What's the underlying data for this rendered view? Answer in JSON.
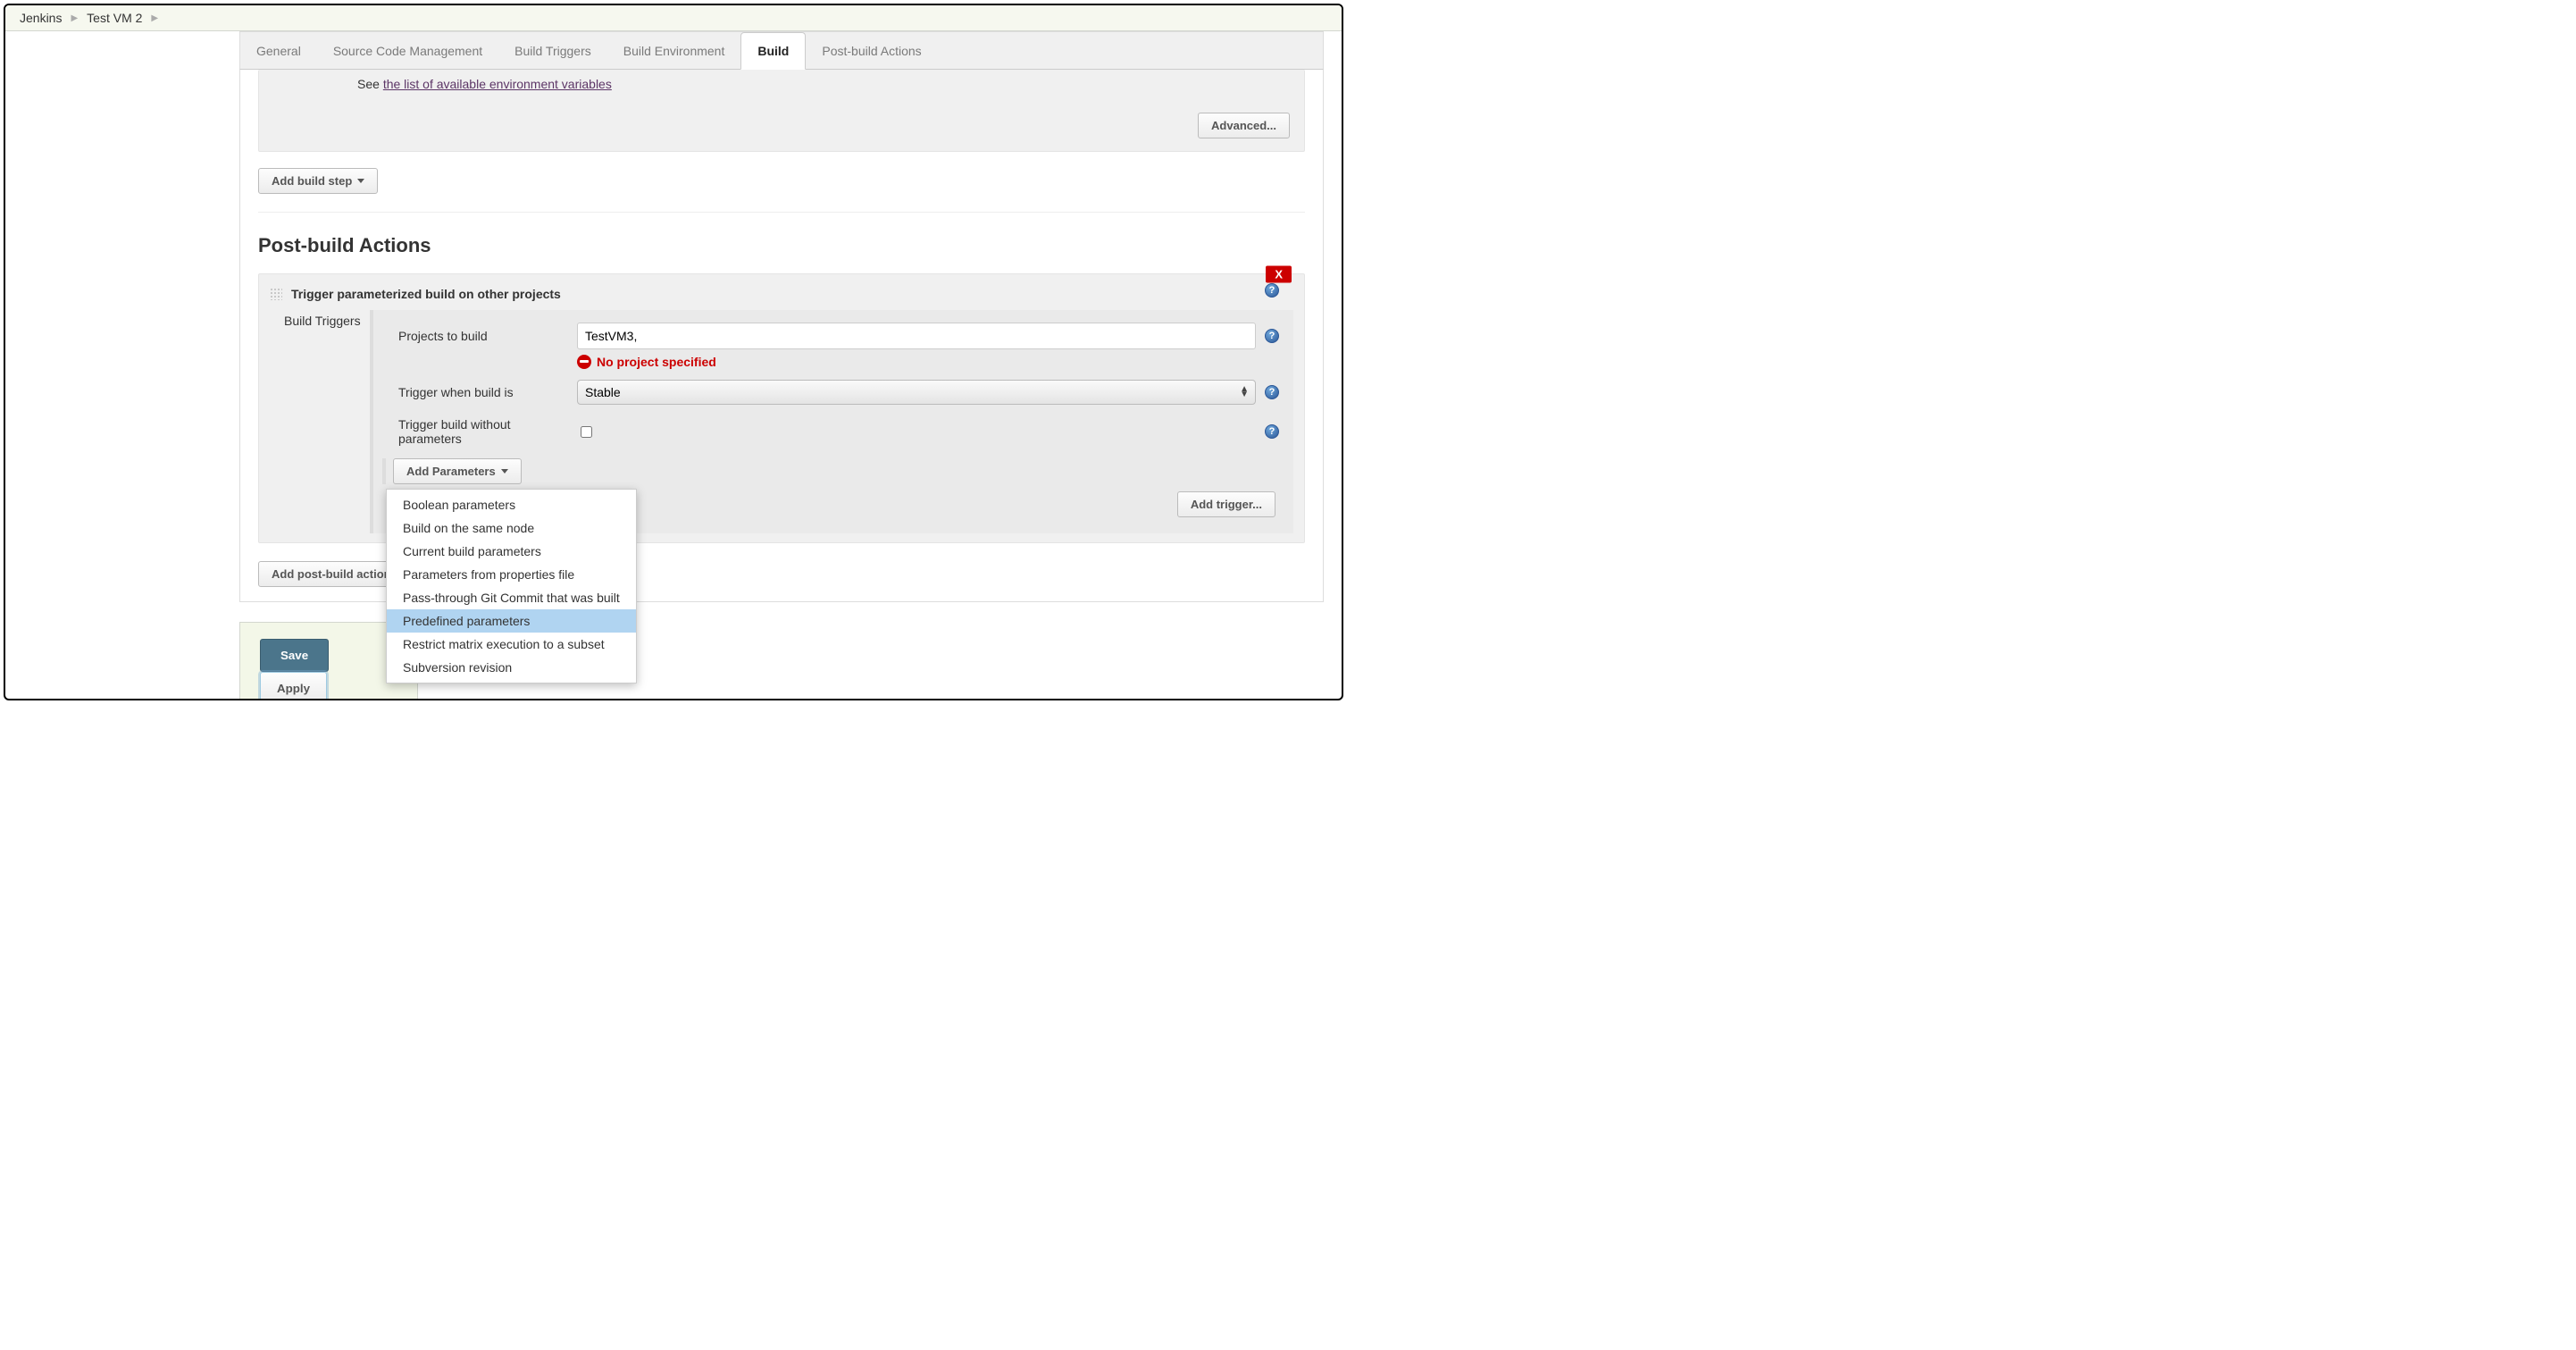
{
  "breadcrumb": {
    "root": "Jenkins",
    "item": "Test VM 2"
  },
  "tabs": {
    "general": "General",
    "scm": "Source Code Management",
    "triggers": "Build Triggers",
    "env": "Build Environment",
    "build": "Build",
    "post": "Post-build Actions"
  },
  "build_section": {
    "env_prefix": "See ",
    "env_link": "the list of available environment variables",
    "advanced": "Advanced...",
    "add_step": "Add build step"
  },
  "post": {
    "heading": "Post-build Actions",
    "delete": "X",
    "panel_title": "Trigger parameterized build on other projects",
    "side_label": "Build Triggers",
    "projects_label": "Projects to build",
    "projects_value": "TestVM3,",
    "error_msg": "No project specified",
    "trigger_when_label": "Trigger when build is",
    "trigger_when_value": "Stable",
    "trigger_without_label": "Trigger build without parameters",
    "add_params": "Add Parameters",
    "add_trigger": "Add trigger...",
    "add_post_action": "Add post-build action"
  },
  "param_menu": {
    "items": [
      "Boolean parameters",
      "Build on the same node",
      "Current build parameters",
      "Parameters from properties file",
      "Pass-through Git Commit that was built",
      "Predefined parameters",
      "Restrict matrix execution to a subset",
      "Subversion revision"
    ],
    "highlight_index": 5
  },
  "footer": {
    "save": "Save",
    "apply": "Apply"
  }
}
